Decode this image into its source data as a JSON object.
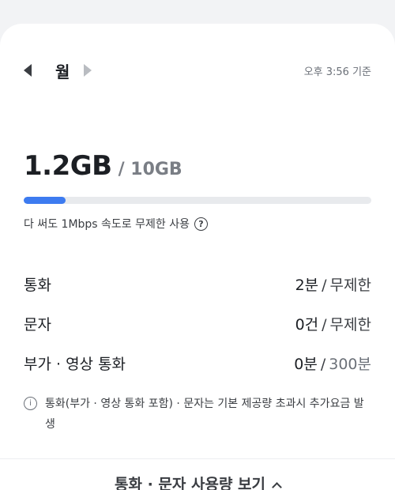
{
  "header": {
    "period_label": "월",
    "timestamp": "오후 3:56 기준"
  },
  "data_usage": {
    "used": "1.2GB",
    "total": "/ 10GB",
    "progress_percent": 12,
    "notice": "다 써도 1Mbps 속도로 무제한 사용",
    "help_symbol": "?"
  },
  "rows": [
    {
      "label": "통화",
      "used": "2분",
      "limit": "무제한"
    },
    {
      "label": "문자",
      "used": "0건",
      "limit": "무제한"
    },
    {
      "label": "부가 · 영상 통화",
      "used": "0분",
      "limit": "300분"
    }
  ],
  "separator": "/",
  "footnote": {
    "icon_symbol": "i",
    "text": "통화(부가 · 영상 통화 포함) · 문자는 기본 제공량 초과시 추가요금 발생"
  },
  "bottom_link": {
    "label": "통화 · 문자 사용량 보기"
  },
  "colors": {
    "accent": "#3d7bf0",
    "track": "#e8eaed",
    "background": "#f2f3f5"
  }
}
